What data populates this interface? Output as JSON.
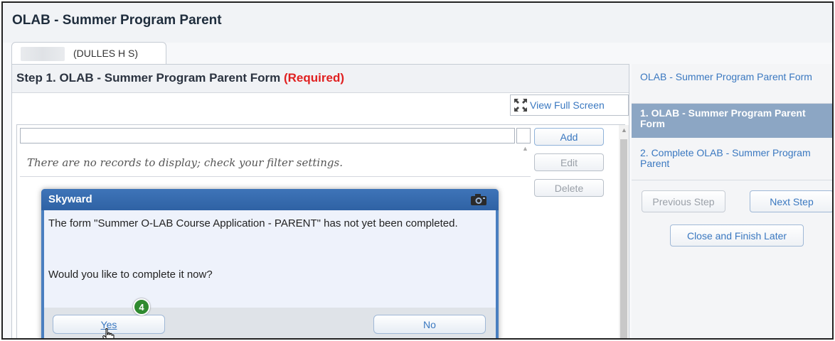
{
  "app": {
    "title": "OLAB - Summer Program Parent"
  },
  "student_tab": {
    "school": "(DULLES H S)"
  },
  "step": {
    "title": "Step 1. OLAB - Summer Program Parent Form",
    "required": "(Required)"
  },
  "toolbar": {
    "fullscreen_label": "View Full Screen"
  },
  "list": {
    "empty_message": "There are no records to display; check your filter settings.",
    "add_label": "Add",
    "edit_label": "Edit",
    "delete_label": "Delete"
  },
  "dialog": {
    "title": "Skyward",
    "message": "The form \"Summer O-LAB Course Application - PARENT\" has not yet been completed.",
    "question": "Would you like to complete it now?",
    "yes_label": "Yes",
    "no_label": "No",
    "step_badge": "4"
  },
  "nav": {
    "header_item": "OLAB - Summer Program Parent Form",
    "item1": "1. OLAB - Summer Program Parent Form",
    "item2": "2. Complete OLAB - Summer Program Parent",
    "previous_label": "Previous Step",
    "next_label": "Next Step",
    "close_label": "Close and Finish Later"
  },
  "colors": {
    "required": "#e02020",
    "link": "#3a78c0",
    "dialog_header": "#2f62a4",
    "nav_active": "#8ca6c4",
    "badge": "#2f8a2f"
  }
}
